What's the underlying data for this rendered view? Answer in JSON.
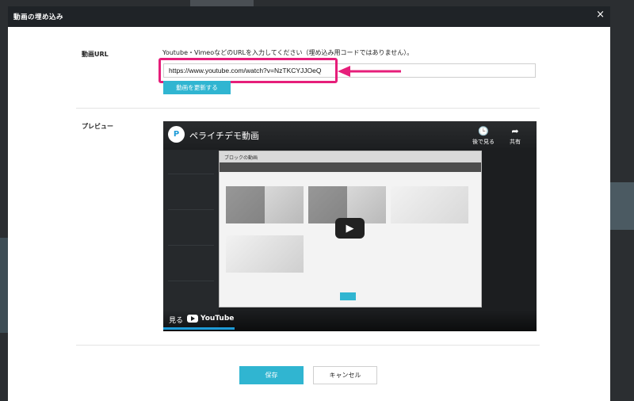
{
  "modal": {
    "title": "動画の埋め込み",
    "close": "×"
  },
  "form": {
    "url_label": "動画URL",
    "hint": "Youtube・VimeoなどのURLを入力してください（埋め込み用コードではありません）。",
    "url_value": "https://www.youtube.com/watch?v=NzTKCYJJOeQ",
    "update_button": "動画を更新する",
    "preview_label": "プレビュー"
  },
  "video": {
    "channel_initial": "P",
    "title": "ペライチデモ動画",
    "watch_later": "後で見る",
    "share": "共有",
    "watch_on": "見る",
    "platform": "YouTube",
    "inner_title": "ブロックの動画"
  },
  "footer": {
    "save": "保存",
    "cancel": "キャンセル"
  },
  "colors": {
    "accent": "#30b5d1",
    "highlight": "#e61e7a",
    "header": "#1f2327"
  }
}
